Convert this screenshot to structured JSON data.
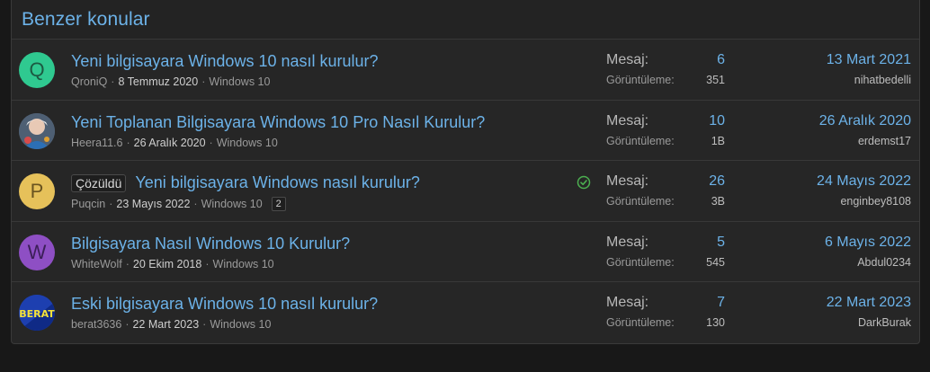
{
  "header": {
    "title": "Benzer konular"
  },
  "labels": {
    "messages": "Mesaj:",
    "views": "Görüntüleme:"
  },
  "threads": [
    {
      "avatar": {
        "letter": "Q",
        "color": "#2fc990",
        "text_color": "#1c5a42"
      },
      "prefix": "",
      "title": "Yeni bilgisayara Windows 10 nasıl kurulur?",
      "author": "QroniQ",
      "date": "8 Temmuz 2020",
      "forum": "Windows 10",
      "pages": "",
      "solved": false,
      "messages": "6",
      "views": "351",
      "last_date": "13 Mart 2021",
      "last_user": "nihatbedelli"
    },
    {
      "avatar": {
        "letter": "",
        "color": "#5a6f86",
        "text_color": "#ffffff",
        "image": "anime-avatar"
      },
      "prefix": "",
      "title": "Yeni Toplanan Bilgisayara Windows 10 Pro Nasıl Kurulur?",
      "author": "Heera11.6",
      "date": "26 Aralık 2020",
      "forum": "Windows 10",
      "pages": "",
      "solved": false,
      "messages": "10",
      "views": "1B",
      "last_date": "26 Aralık 2020",
      "last_user": "erdemst17"
    },
    {
      "avatar": {
        "letter": "P",
        "color": "#e6c15a",
        "text_color": "#6a5420"
      },
      "prefix": "Çözüldü",
      "title": "Yeni bilgisayara Windows nasıl kurulur?",
      "author": "Puqcin",
      "date": "23 Mayıs 2022",
      "forum": "Windows 10",
      "pages": "2",
      "solved": true,
      "messages": "26",
      "views": "3B",
      "last_date": "24 Mayıs 2022",
      "last_user": "enginbey8108"
    },
    {
      "avatar": {
        "letter": "W",
        "color": "#8e4fc4",
        "text_color": "#3c1f58"
      },
      "prefix": "",
      "title": "Bilgisayara Nasıl Windows 10 Kurulur?",
      "author": "WhiteWolf",
      "date": "20 Ekim 2018",
      "forum": "Windows 10",
      "pages": "",
      "solved": false,
      "messages": "5",
      "views": "545",
      "last_date": "6 Mayıs 2022",
      "last_user": "Abdul0234"
    },
    {
      "avatar": {
        "letter": "BERAT",
        "color": "#1d3fb0",
        "text_color": "#f5e23a",
        "image": "berat-logo"
      },
      "prefix": "",
      "title": "Eski bilgisayara Windows 10 nasıl kurulur?",
      "author": "berat3636",
      "date": "22 Mart 2023",
      "forum": "Windows 10",
      "pages": "",
      "solved": false,
      "messages": "7",
      "views": "130",
      "last_date": "22 Mart 2023",
      "last_user": "DarkBurak"
    }
  ],
  "icons": {
    "solved": "check-circle-icon"
  },
  "colors": {
    "link": "#6cb2e8",
    "solved": "#4caf50",
    "background": "#262626"
  }
}
